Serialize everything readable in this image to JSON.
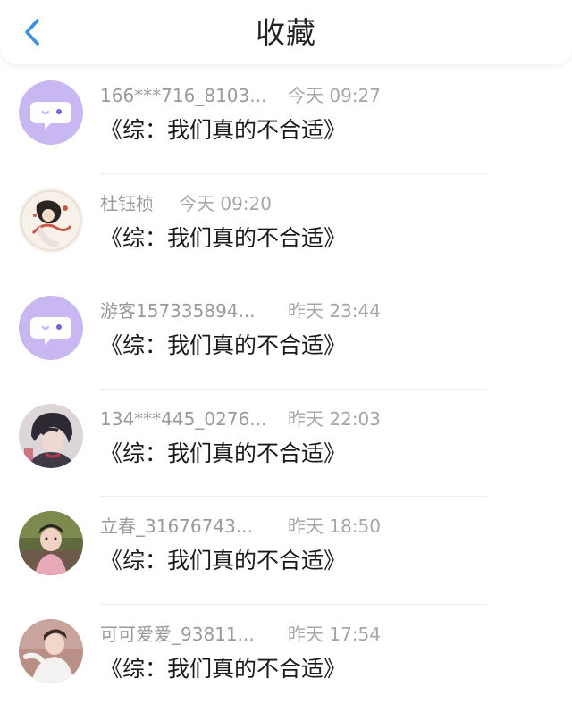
{
  "header": {
    "title": "收藏",
    "back_icon": "chevron-left-icon",
    "accent_color": "#3a8fe0"
  },
  "items": [
    {
      "username": "166***716_8103...",
      "time": "今天 09:27",
      "title": "《综：我们真的不合适》",
      "avatar": "chat-bubble-placeholder"
    },
    {
      "username": "杜钰桢",
      "time": "今天 09:20",
      "title": "《综：我们真的不合适》",
      "avatar": "anime-illustration"
    },
    {
      "username": "游客157335894...",
      "time": "昨天 23:44",
      "title": "《综：我们真的不合适》",
      "avatar": "chat-bubble-placeholder"
    },
    {
      "username": "134***445_0276...",
      "time": "昨天 22:03",
      "title": "《综：我们真的不合适》",
      "avatar": "anime-portrait"
    },
    {
      "username": "立春_31676743...",
      "time": "昨天 18:50",
      "title": "《综：我们真的不合适》",
      "avatar": "child-photo"
    },
    {
      "username": "可可爱爱_93811...",
      "time": "昨天 17:54",
      "title": "《综：我们真的不合适》",
      "avatar": "child-photo"
    }
  ]
}
